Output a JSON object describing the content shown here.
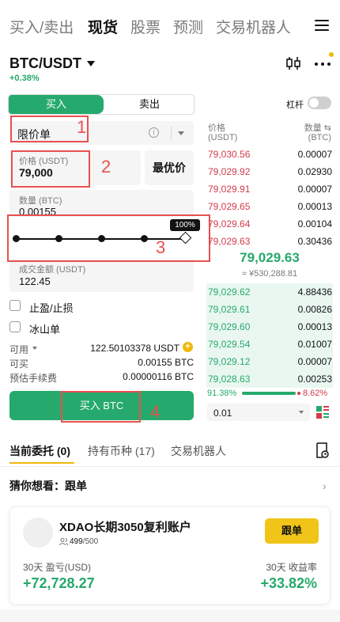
{
  "nav": {
    "tabs": [
      {
        "label": "买入/卖出"
      },
      {
        "label": "现货"
      },
      {
        "label": "股票"
      },
      {
        "label": "预测"
      },
      {
        "label": "交易机器人"
      }
    ]
  },
  "pair": {
    "symbol": "BTC/USDT",
    "change": "+0.38%"
  },
  "trade": {
    "buy_label": "买入",
    "sell_label": "卖出",
    "order_type": "限价单",
    "price_label": "价格 (USDT)",
    "price_value": "79,000",
    "best_price_label": "最优价",
    "qty_label": "数量 (BTC)",
    "qty_value": "0.00155",
    "slider_pct": "100%",
    "slider_value": 1.0,
    "total_label": "成交金额 (USDT)",
    "total_value": "122.45",
    "tp_sl_label": "止盈/止损",
    "iceberg_label": "冰山单",
    "info": [
      {
        "label": "可用",
        "value": "122.50103378 USDT"
      },
      {
        "label": "可买",
        "value": "0.00155 BTC"
      },
      {
        "label": "预估手续费",
        "value": "0.00000116 BTC"
      }
    ],
    "buy_button": "买入 BTC"
  },
  "annotations": [
    "1",
    "2",
    "3",
    "4"
  ],
  "orderbook": {
    "leverage_label": "杠杆",
    "price_header": "价格",
    "price_unit": "(USDT)",
    "qty_header": "数量 ⇆",
    "qty_unit": "(BTC)",
    "asks": [
      {
        "price": "79,030.56",
        "qty": "0.00007"
      },
      {
        "price": "79,029.92",
        "qty": "0.02930"
      },
      {
        "price": "79,029.91",
        "qty": "0.00007"
      },
      {
        "price": "79,029.65",
        "qty": "0.00013"
      },
      {
        "price": "79,029.64",
        "qty": "0.00104"
      },
      {
        "price": "79,029.63",
        "qty": "0.30436"
      }
    ],
    "mid_price": "79,029.63",
    "mid_cny": "≈ ¥530,288.81",
    "bids": [
      {
        "price": "79,029.62",
        "qty": "4.88436"
      },
      {
        "price": "79,029.61",
        "qty": "0.00826"
      },
      {
        "price": "79,029.60",
        "qty": "0.00013"
      },
      {
        "price": "79,029.54",
        "qty": "0.01007"
      },
      {
        "price": "79,029.12",
        "qty": "0.00007"
      },
      {
        "price": "79,028.63",
        "qty": "0.00253"
      }
    ],
    "buy_ratio": "91.38%",
    "sell_ratio": "8.62%",
    "buy_ratio_value": 0.9138,
    "depth": "0.01"
  },
  "bottom_tabs": [
    {
      "label": "当前委托 (0)"
    },
    {
      "label": "持有币种 (17)"
    },
    {
      "label": "交易机器人"
    }
  ],
  "guess": {
    "label": "猜你想看：跟单"
  },
  "copy_card": {
    "name": "XDAO长期3050复利账户",
    "members_current": "499",
    "members_total": "/500",
    "follow_label": "跟单",
    "pnl_label": "30天 盈亏(USD)",
    "pnl_value": "+72,728.27",
    "roi_label": "30天 收益率",
    "roi_value": "+33.82%"
  },
  "colors": {
    "buy": "#26a96c",
    "sell": "#d23b4b",
    "accent": "#f0b90b",
    "annotation": "#e85050"
  }
}
